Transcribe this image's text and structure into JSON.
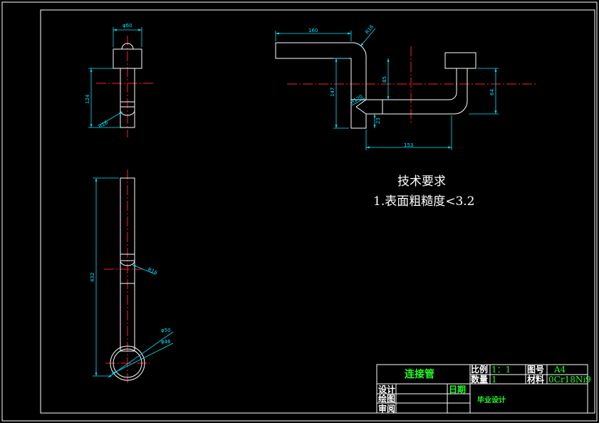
{
  "dimensions": {
    "top_view_width": "φ60",
    "top_view_radius": "R16",
    "top_view_height": "124",
    "front_width": "160",
    "front_bend_radius": "R16",
    "front_height_85": "85",
    "front_height_147": "147",
    "front_height_64": "64",
    "front_small_23": "23",
    "front_width_153": "153",
    "front_radius_120": "R120",
    "side_length": "432",
    "side_radius": "R16",
    "side_outer_dia": "φ50",
    "side_inner_dia": "φ46"
  },
  "technical_requirements": {
    "heading": "技术要求",
    "item_1": "1.表面粗糙度<3.2"
  },
  "title_block": {
    "part_name": "连接管",
    "scale_label": "比例",
    "scale_value": "1：1",
    "sheet_label": "图号",
    "sheet_value": "A4",
    "quantity_label": "数量",
    "quantity_value": "1",
    "material_label": "材料",
    "material_value": "0Cr18Ni9",
    "design_label": "设计",
    "drawing_label": "绘图",
    "review_label": "审阅",
    "date_label": "日期",
    "project": "毕业设计"
  }
}
